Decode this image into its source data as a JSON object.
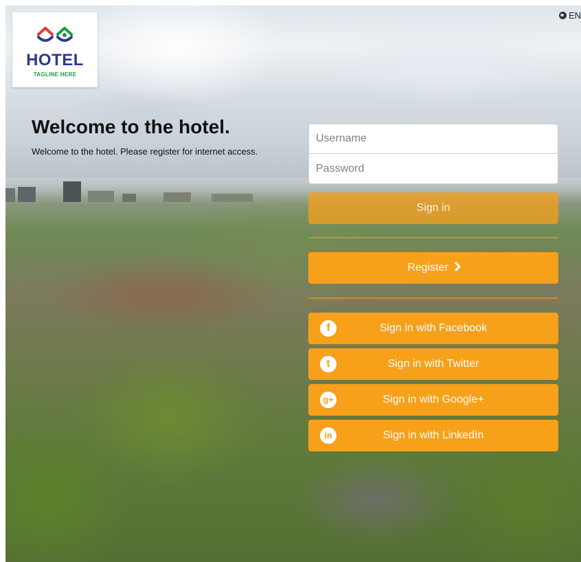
{
  "logo": {
    "name": "HOTEL",
    "tagline": "TAGLINE HERE"
  },
  "language": {
    "label": "EN",
    "icon": "globe-icon"
  },
  "welcome": {
    "title": "Welcome to the hotel.",
    "subtitle": "Welcome to the hotel. Please register for internet access."
  },
  "login": {
    "username_placeholder": "Username",
    "password_placeholder": "Password",
    "signin_label": "Sign in"
  },
  "register": {
    "label": "Register",
    "icon": "chevron-right-icon"
  },
  "social": [
    {
      "label": "Sign in with Facebook",
      "icon": "facebook-icon",
      "glyph": "f"
    },
    {
      "label": "Sign in with Twitter",
      "icon": "twitter-icon",
      "glyph": "t"
    },
    {
      "label": "Sign in with Google+",
      "icon": "google-plus-icon",
      "glyph": "g+"
    },
    {
      "label": "Sign in with LinkedIn",
      "icon": "linkedin-icon",
      "glyph": "in"
    }
  ],
  "colors": {
    "accent": "#f7a01a",
    "logo_text": "#2b3990",
    "logo_tagline": "#1a9a47"
  }
}
